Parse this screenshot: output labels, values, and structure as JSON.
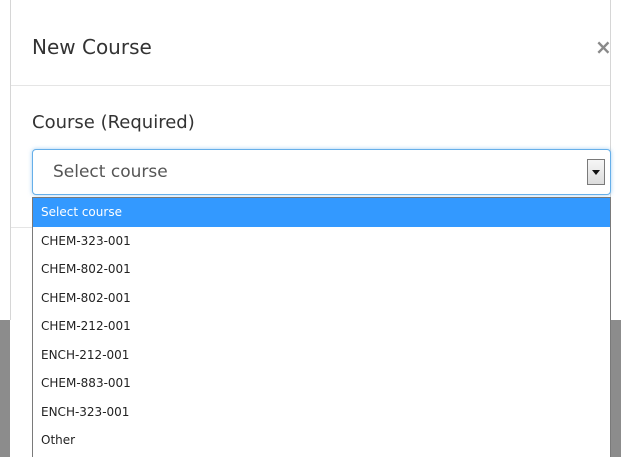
{
  "modal": {
    "title": "New Course",
    "close_label": "×"
  },
  "course_field": {
    "label": "Course (Required)",
    "selected_value": "Select course",
    "options": [
      "Select course",
      "CHEM-323-001",
      "CHEM-802-001",
      "CHEM-802-001",
      "CHEM-212-001",
      "ENCH-212-001",
      "CHEM-883-001",
      "ENCH-323-001",
      "Other"
    ],
    "highlighted_option": "Select course"
  },
  "colors": {
    "highlight": "#3399ff",
    "focus_border": "#66afe9",
    "backdrop": "#8c8c8c"
  },
  "icons": {
    "close": "close-icon",
    "dropdown": "chevron-down-icon"
  }
}
